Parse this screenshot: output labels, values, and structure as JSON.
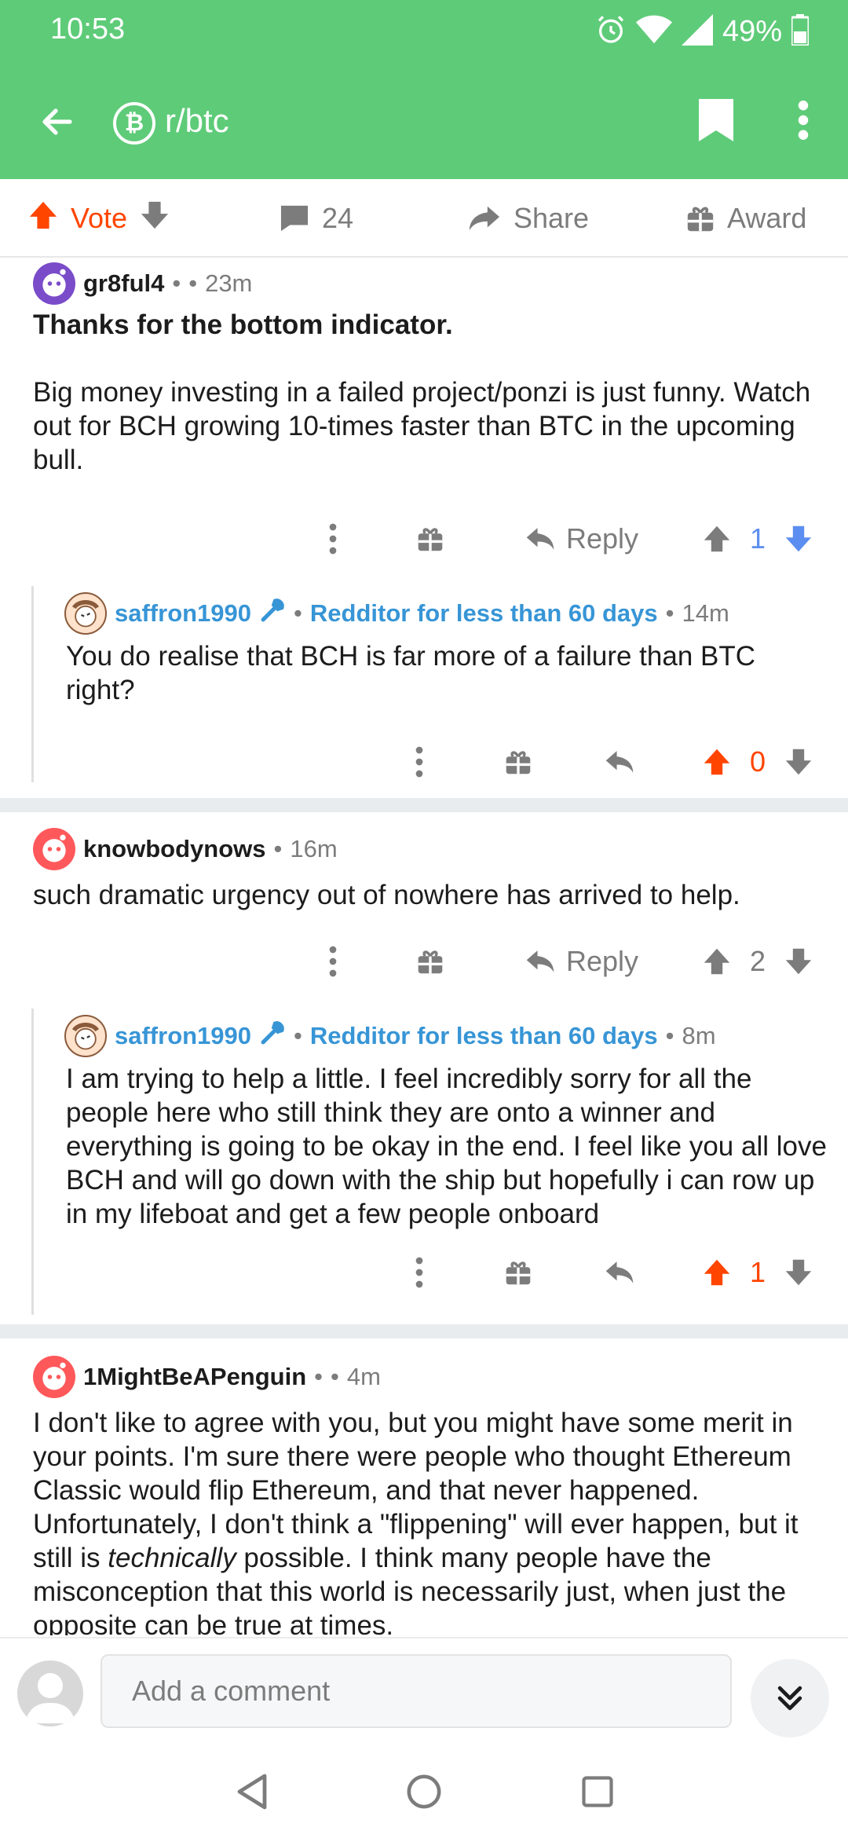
{
  "status_bar": {
    "time": "10:53",
    "battery": "49%"
  },
  "appbar": {
    "subreddit": "r/btc",
    "sub_icon": "bitcoin-icon"
  },
  "post_actions": {
    "vote_label": "Vote",
    "comment_count": "24",
    "share_label": "Share",
    "award_label": "Award"
  },
  "comments": [
    {
      "author": "gr8ful4",
      "separator": "•",
      "separator2": "•",
      "time": "23m",
      "body_bold": "Thanks for the bottom indicator.",
      "body": "Big money investing in a failed project/ponzi is just funny. Watch out for BCH growing 10-times faster than BTC in the upcoming bull.",
      "reply_label": "Reply",
      "score": "1",
      "score_color": "#5b8ef0"
    },
    {
      "author": "saffron1990",
      "separator": "•",
      "flair": "Redditor for less than 60 days",
      "separator2": "•",
      "time": "14m",
      "body": "You do realise that BCH is far more of a failure than BTC right?",
      "score": "0",
      "score_color": "#ff4500"
    },
    {
      "author": "knowbodynows",
      "separator": "•",
      "time": "16m",
      "body": "such dramatic urgency out of nowhere has arrived to help.",
      "reply_label": "Reply",
      "score": "2",
      "score_color": "#7c7c7c"
    },
    {
      "author": "saffron1990",
      "separator": "•",
      "flair": "Redditor for less than 60 days",
      "separator2": "•",
      "time": "8m",
      "body": "I am trying to help a little. I feel incredibly sorry for all the people here who still think they are onto a winner and everything is going to be okay in the end. I feel like you all love BCH and will go down with the ship but hopefully i can row up in my lifeboat and get a few people onboard",
      "score": "1",
      "score_color": "#ff4500"
    },
    {
      "author": "1MightBeAPenguin",
      "separator": "•",
      "separator2": "•",
      "time": "4m",
      "body_part1": "I don't like to agree with you, but you might have some merit in your points. I'm sure there were people who thought Ethereum Classic would flip Ethereum, and that never happened. Unfortunately, I don't think a \"flippening\" will ever happen, but it still is ",
      "body_italic": "technically",
      "body_part2": " possible. I think many people have the misconception that this world is necessarily just, when just the opposite can be true at times."
    }
  ],
  "comment_bar": {
    "placeholder": "Add a comment"
  }
}
